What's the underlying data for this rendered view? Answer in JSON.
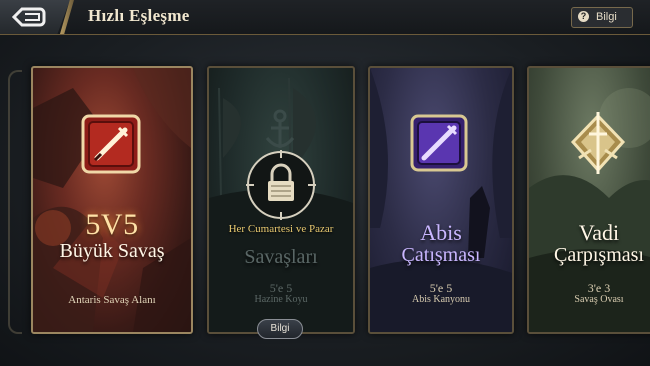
{
  "header": {
    "title": "Hızlı Eşleşme",
    "info_label": "Bilgi"
  },
  "cards": [
    {
      "big_label": "5V5",
      "name": "Büyük Savaş",
      "map": "Antaris Savaş Alanı"
    },
    {
      "schedule": "Her Cumartesi ve Pazar",
      "name": "Savaşları",
      "format": "5'e 5",
      "map": "Hazine Koyu",
      "info_button": "Bilgi"
    },
    {
      "name_line1": "Abis",
      "name_line2": "Çatışması",
      "format": "5'e 5",
      "map": "Abis Kanyonu"
    },
    {
      "name_line1": "Vadi",
      "name_line2": "Çarpışması",
      "format": "3'e 3",
      "map": "Savaş Ovası"
    }
  ],
  "icons": [
    "back-arrow-icon",
    "question-icon",
    "crossed-swords-icon",
    "padlock-icon",
    "anchor-icon",
    "sword-emblem-icon"
  ]
}
